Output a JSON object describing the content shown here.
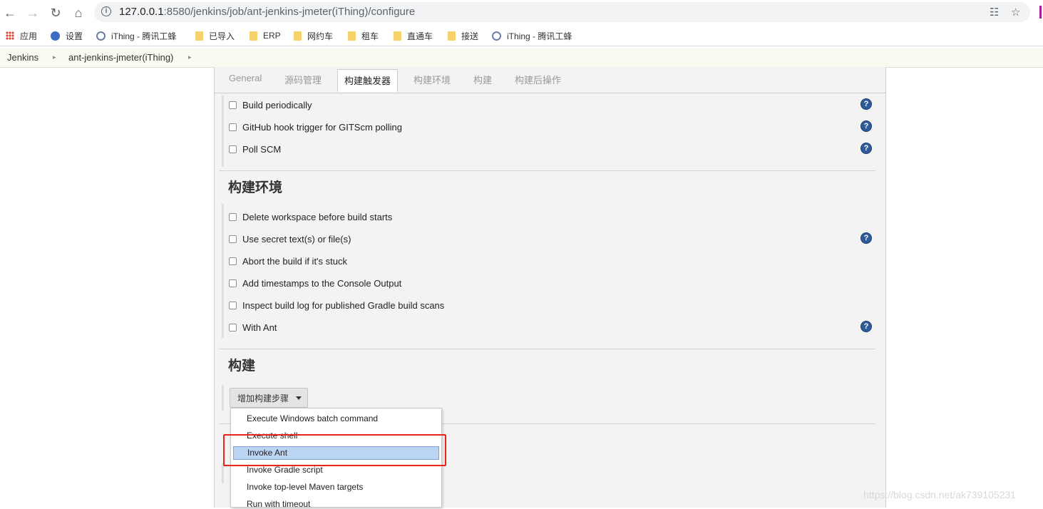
{
  "browser": {
    "url_host": "127.0.0.1",
    "url_rest": ":8580/jenkins/job/ant-jenkins-jmeter(iThing)/configure",
    "bookmarks": [
      {
        "label": "应用",
        "icon": "apps-grid-icon"
      },
      {
        "label": "设置",
        "icon": "gear-icon"
      },
      {
        "label": "iThing - 腾讯工蜂",
        "icon": "globe-icon"
      },
      {
        "label": "已导入",
        "icon": "folder-icon"
      },
      {
        "label": "ERP",
        "icon": "folder-icon"
      },
      {
        "label": "网约车",
        "icon": "folder-icon"
      },
      {
        "label": "租车",
        "icon": "folder-icon"
      },
      {
        "label": "直通车",
        "icon": "folder-icon"
      },
      {
        "label": "接送",
        "icon": "folder-icon"
      },
      {
        "label": "iThing - 腾讯工蜂",
        "icon": "globe-icon"
      }
    ]
  },
  "breadcrumb": [
    "Jenkins",
    "ant-jenkins-jmeter(iThing)"
  ],
  "tabs": [
    "General",
    "源码管理",
    "构建触发器",
    "构建环境",
    "构建",
    "构建后操作"
  ],
  "triggers": [
    "Build periodically",
    "GitHub hook trigger for GITScm polling",
    "Poll SCM"
  ],
  "env": {
    "title": "构建环境",
    "options": [
      "Delete workspace before build starts",
      "Use secret text(s) or file(s)",
      "Abort the build if it's stuck",
      "Add timestamps to the Console Output",
      "Inspect build log for published Gradle build scans",
      "With Ant"
    ]
  },
  "build": {
    "title": "构建",
    "add_step_label": "增加构建步骤",
    "menu": [
      "Execute Windows batch command",
      "Execute shell",
      "Invoke Ant",
      "Invoke Gradle script",
      "Invoke top-level Maven targets",
      "Run with timeout"
    ]
  },
  "help_glyph": "?",
  "watermark": "https://blog.csdn.net/ak739105231",
  "colors": {
    "highlight": "#e8241c",
    "help": "#2e5b9a",
    "menu_selected": "#bcd5f5"
  }
}
